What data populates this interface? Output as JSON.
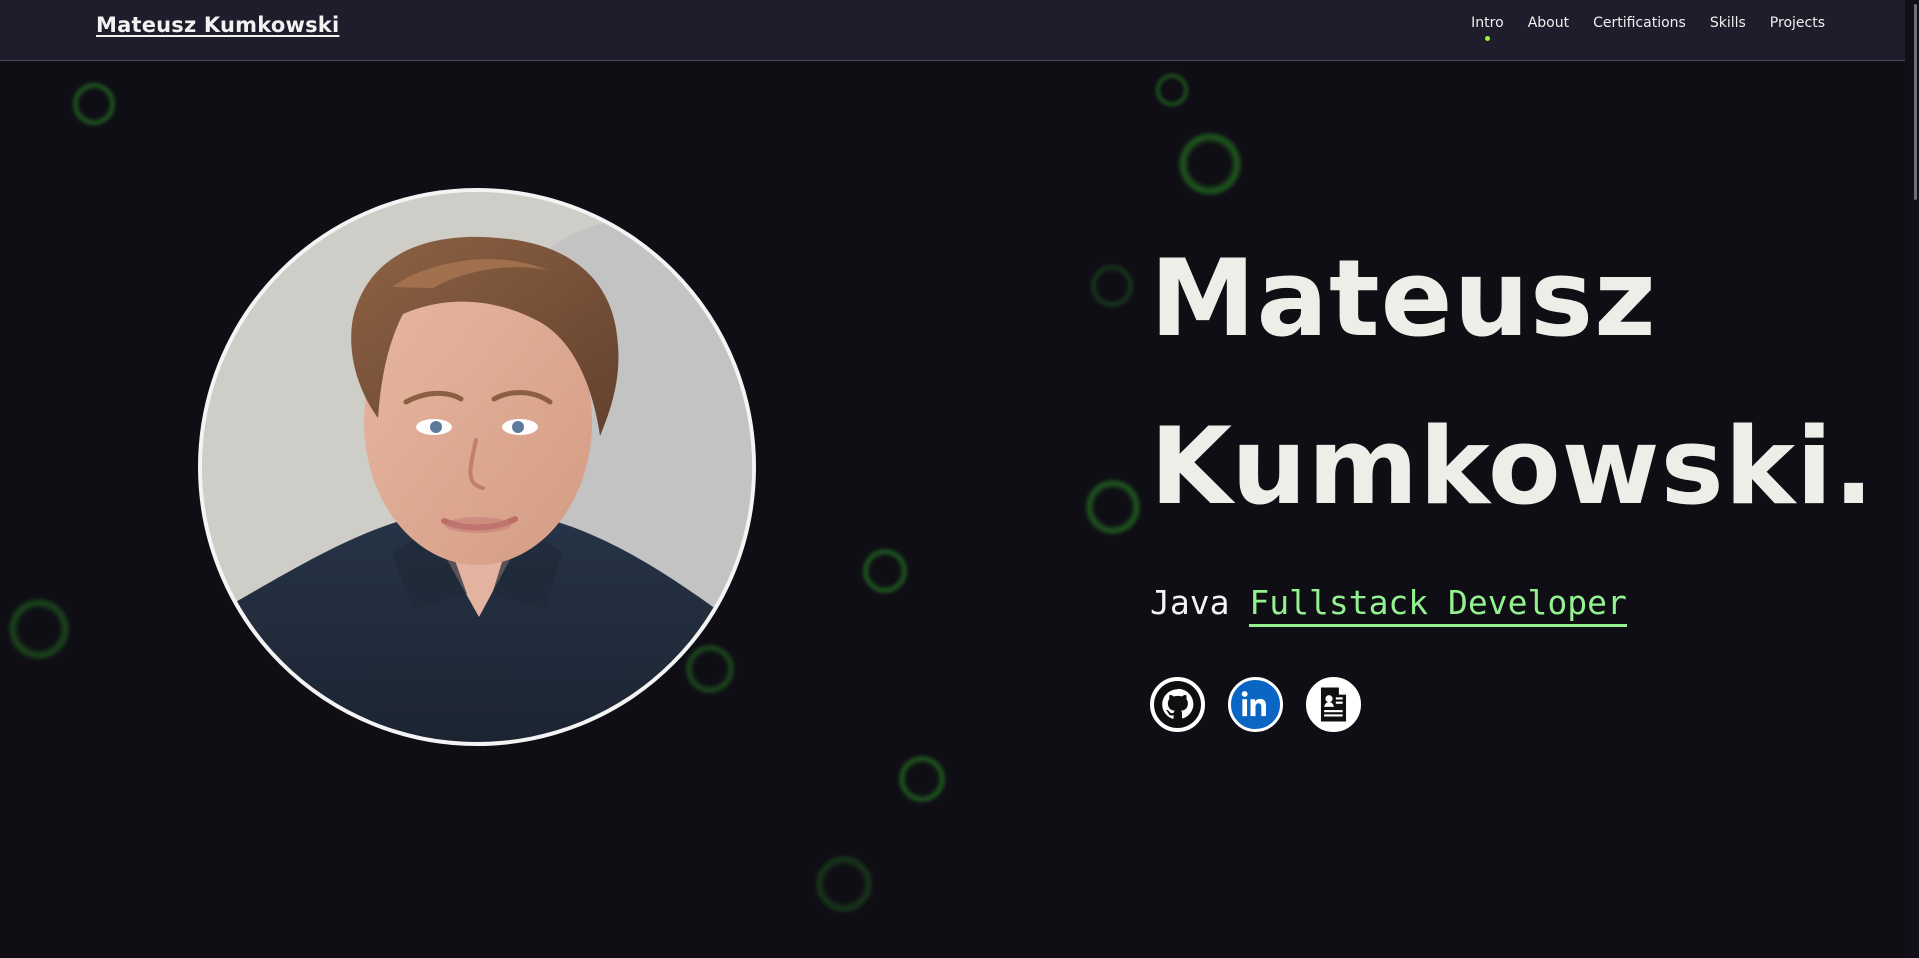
{
  "navbar": {
    "brand": "Mateusz Kumkowski",
    "links": [
      {
        "label": "Intro",
        "active": true
      },
      {
        "label": "About",
        "active": false
      },
      {
        "label": "Certifications",
        "active": false
      },
      {
        "label": "Skills",
        "active": false
      },
      {
        "label": "Projects",
        "active": false
      }
    ],
    "active_indicator_color": "#a6ef2b"
  },
  "hero": {
    "name_line_1": "Mateusz",
    "name_line_2": "Kumkowski.",
    "role_prefix": "Java",
    "role_highlight": "Fullstack Developer",
    "highlight_color": "#93f28f",
    "socials": [
      {
        "name": "github",
        "icon": "github-icon"
      },
      {
        "name": "linkedin",
        "icon": "linkedin-icon"
      },
      {
        "name": "resume",
        "icon": "resume-icon"
      }
    ]
  },
  "colors": {
    "background": "#0f0e15",
    "navbar": "#1f1d2b",
    "accent_green": "#93f28f",
    "linkedin_blue": "#0a66c2"
  }
}
